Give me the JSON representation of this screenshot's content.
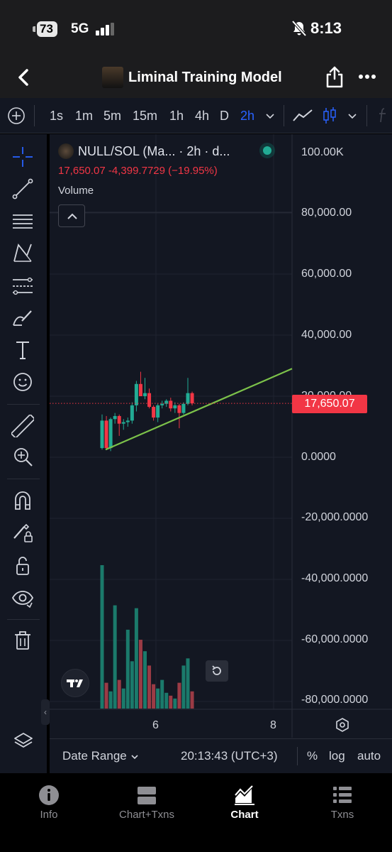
{
  "status": {
    "battery": "73",
    "network": "5G",
    "time": "8:13"
  },
  "header": {
    "title": "Liminal Training Model"
  },
  "timeframes": [
    "1s",
    "1m",
    "5m",
    "15m",
    "1h",
    "4h",
    "D",
    "2h"
  ],
  "active_timeframe": "2h",
  "legend": {
    "symbol": "NULL/SOL (Ma... · 2h · d...",
    "values": "17,650.07  -4,399.7729 (−19.95%)",
    "volume_label": "Volume"
  },
  "price_axis": [
    "100.00K",
    "80,000.00",
    "60,000.00",
    "40,000.00",
    "20,000.00",
    "0.0000",
    "-20,000.0000",
    "-40,000.0000",
    "-60,000.0000",
    "-80,000.0000"
  ],
  "last_price": "17,650.07",
  "time_axis": [
    "6",
    "8"
  ],
  "bottom": {
    "date_range": "Date Range",
    "clock": "20:13:43 (UTC+3)",
    "percent": "%",
    "log": "log",
    "auto": "auto"
  },
  "tabs": [
    {
      "label": "Info",
      "active": false
    },
    {
      "label": "Chart+Txns",
      "active": false
    },
    {
      "label": "Chart",
      "active": true
    },
    {
      "label": "Txns",
      "active": false
    }
  ],
  "colors": {
    "up": "#22ab94",
    "down": "#f23645",
    "accent": "#2962ff",
    "trendline": "#7cc24a",
    "background": "#131722"
  },
  "chart_data": {
    "type": "candlestick",
    "y_axis_range": [
      -85000,
      100000
    ],
    "last_price": 17650.07,
    "change": -4399.7729,
    "change_percent": -19.95,
    "candles": [
      {
        "o": 3000,
        "h": 14000,
        "l": 2500,
        "c": 12000
      },
      {
        "o": 12000,
        "h": 13500,
        "l": 2500,
        "c": 3000
      },
      {
        "o": 3000,
        "h": 13000,
        "l": 2000,
        "c": 12500
      },
      {
        "o": 12500,
        "h": 14500,
        "l": 11000,
        "c": 13500
      },
      {
        "o": 13500,
        "h": 14000,
        "l": 7000,
        "c": 11000
      },
      {
        "o": 11000,
        "h": 12500,
        "l": 9000,
        "c": 11500
      },
      {
        "o": 11500,
        "h": 13000,
        "l": 10000,
        "c": 12000
      },
      {
        "o": 12000,
        "h": 18000,
        "l": 11000,
        "c": 17000
      },
      {
        "o": 17000,
        "h": 25000,
        "l": 15000,
        "c": 24000
      },
      {
        "o": 24000,
        "h": 28000,
        "l": 21000,
        "c": 20000
      },
      {
        "o": 20000,
        "h": 26000,
        "l": 19000,
        "c": 21000
      },
      {
        "o": 21000,
        "h": 22500,
        "l": 16000,
        "c": 16500
      },
      {
        "o": 16500,
        "h": 17000,
        "l": 12000,
        "c": 13000
      },
      {
        "o": 13000,
        "h": 17500,
        "l": 11500,
        "c": 17000
      },
      {
        "o": 17000,
        "h": 18500,
        "l": 16000,
        "c": 17500
      },
      {
        "o": 17500,
        "h": 19000,
        "l": 16500,
        "c": 18500
      },
      {
        "o": 18500,
        "h": 19500,
        "l": 15000,
        "c": 16000
      },
      {
        "o": 16000,
        "h": 18000,
        "l": 14500,
        "c": 17000
      },
      {
        "o": 17000,
        "h": 17500,
        "l": 9500,
        "c": 14500
      },
      {
        "o": 14500,
        "h": 18000,
        "l": 14000,
        "c": 17500
      },
      {
        "o": 17500,
        "h": 26000,
        "l": 17000,
        "c": 21000
      },
      {
        "o": 21000,
        "h": 21500,
        "l": 17000,
        "c": 17650
      }
    ],
    "volume": [
      100,
      18,
      12,
      72,
      20,
      14,
      55,
      33,
      70,
      48,
      40,
      30,
      17,
      14,
      20,
      11,
      9,
      7,
      18,
      30,
      35,
      12
    ],
    "trendline": {
      "start_value": 2500,
      "end_value": 29000
    }
  }
}
